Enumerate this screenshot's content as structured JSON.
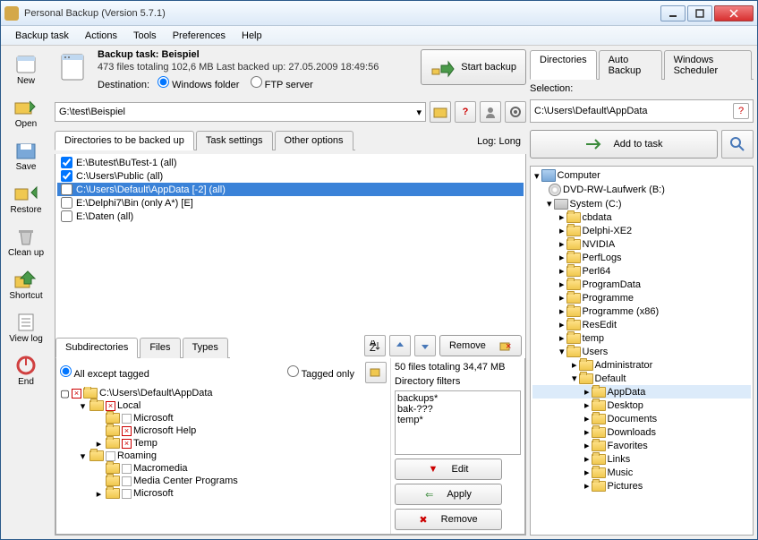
{
  "window": {
    "title": "Personal Backup (Version 5.7.1)"
  },
  "menu": [
    "Backup task",
    "Actions",
    "Tools",
    "Preferences",
    "Help"
  ],
  "sidebar": [
    {
      "label": "New"
    },
    {
      "label": "Open"
    },
    {
      "label": "Save"
    },
    {
      "label": "Restore"
    },
    {
      "label": "Clean up"
    },
    {
      "label": "Shortcut"
    },
    {
      "label": "View log"
    },
    {
      "label": "End"
    }
  ],
  "task": {
    "name_label": "Backup task: Beispiel",
    "stats": "473 files totaling 102,6 MB    Last backed up:  27.05.2009 18:49:56",
    "dest_label": "Destination:",
    "radio_winfolder": "Windows folder",
    "radio_ftp": "FTP server",
    "start_label": "Start backup",
    "dest_path": "G:\\test\\Beispiel"
  },
  "maintabs": [
    "Directories to be backed up",
    "Task settings",
    "Other options"
  ],
  "log_label": "Log: Long",
  "dirs": [
    {
      "text": "E:\\Butest\\BuTest-1 (all)",
      "checked": true
    },
    {
      "text": "C:\\Users\\Public (all)",
      "checked": true
    },
    {
      "text": "C:\\Users\\Default\\AppData [-2] (all)",
      "checked": false,
      "selected": true
    },
    {
      "text": "E:\\Delphi7\\Bin (only A*) [E]",
      "checked": false
    },
    {
      "text": "E:\\Daten (all)",
      "checked": false
    }
  ],
  "remove_label": "Remove",
  "subtabs": [
    "Subdirectories",
    "Files",
    "Types"
  ],
  "filter": {
    "all_except": "All except tagged",
    "tagged_only": "Tagged only",
    "stats": "50 files totaling 34,47 MB",
    "dirfilters_label": "Directory filters",
    "filters": [
      "backups*",
      "bak-???",
      "temp*"
    ]
  },
  "subtree": {
    "root": "C:\\Users\\Default\\AppData",
    "nodes": [
      {
        "label": "Local",
        "depth": 1,
        "expandable": true,
        "open": true,
        "tag": "x"
      },
      {
        "label": "Microsoft",
        "depth": 2,
        "expandable": false,
        "tag": "none"
      },
      {
        "label": "Microsoft Help",
        "depth": 2,
        "expandable": false,
        "tag": "x"
      },
      {
        "label": "Temp",
        "depth": 2,
        "expandable": true,
        "open": false,
        "tag": "x"
      },
      {
        "label": "Roaming",
        "depth": 1,
        "expandable": true,
        "open": true,
        "tag": "none"
      },
      {
        "label": "Macromedia",
        "depth": 2,
        "expandable": false,
        "tag": "none"
      },
      {
        "label": "Media Center Programs",
        "depth": 2,
        "expandable": false,
        "tag": "none"
      },
      {
        "label": "Microsoft",
        "depth": 2,
        "expandable": true,
        "open": false,
        "tag": "none"
      }
    ]
  },
  "filterbtns": {
    "edit": "Edit",
    "apply": "Apply",
    "remove": "Remove"
  },
  "righttabs": [
    "Directories",
    "Auto Backup",
    "Windows Scheduler"
  ],
  "selection": {
    "label": "Selection:",
    "path": "C:\\Users\\Default\\AppData",
    "add_label": "Add to task"
  },
  "rtree": [
    {
      "label": "Computer",
      "depth": 0,
      "icon": "comp",
      "expandable": true,
      "open": true
    },
    {
      "label": "DVD-RW-Laufwerk (B:)",
      "depth": 1,
      "icon": "disc",
      "expandable": false
    },
    {
      "label": "System (C:)",
      "depth": 1,
      "icon": "drive",
      "expandable": true,
      "open": true
    },
    {
      "label": "cbdata",
      "depth": 2,
      "icon": "folder",
      "expandable": true
    },
    {
      "label": "Delphi-XE2",
      "depth": 2,
      "icon": "folder",
      "expandable": true
    },
    {
      "label": "NVIDIA",
      "depth": 2,
      "icon": "folder",
      "expandable": true
    },
    {
      "label": "PerfLogs",
      "depth": 2,
      "icon": "folder",
      "expandable": true
    },
    {
      "label": "Perl64",
      "depth": 2,
      "icon": "folder",
      "expandable": true
    },
    {
      "label": "ProgramData",
      "depth": 2,
      "icon": "folder",
      "expandable": true
    },
    {
      "label": "Programme",
      "depth": 2,
      "icon": "folder",
      "expandable": true
    },
    {
      "label": "Programme (x86)",
      "depth": 2,
      "icon": "folder",
      "expandable": true
    },
    {
      "label": "ResEdit",
      "depth": 2,
      "icon": "folder",
      "expandable": true
    },
    {
      "label": "temp",
      "depth": 2,
      "icon": "folder",
      "expandable": true
    },
    {
      "label": "Users",
      "depth": 2,
      "icon": "folder",
      "expandable": true,
      "open": true
    },
    {
      "label": "Administrator",
      "depth": 3,
      "icon": "folder",
      "expandable": true
    },
    {
      "label": "Default",
      "depth": 3,
      "icon": "folder",
      "expandable": true,
      "open": true
    },
    {
      "label": "AppData",
      "depth": 4,
      "icon": "folder",
      "expandable": true,
      "selected": true
    },
    {
      "label": "Desktop",
      "depth": 4,
      "icon": "folder",
      "expandable": true
    },
    {
      "label": "Documents",
      "depth": 4,
      "icon": "folder",
      "expandable": true
    },
    {
      "label": "Downloads",
      "depth": 4,
      "icon": "folder",
      "expandable": true
    },
    {
      "label": "Favorites",
      "depth": 4,
      "icon": "folder",
      "expandable": true
    },
    {
      "label": "Links",
      "depth": 4,
      "icon": "folder",
      "expandable": true
    },
    {
      "label": "Music",
      "depth": 4,
      "icon": "folder",
      "expandable": true
    },
    {
      "label": "Pictures",
      "depth": 4,
      "icon": "folder",
      "expandable": true
    }
  ]
}
